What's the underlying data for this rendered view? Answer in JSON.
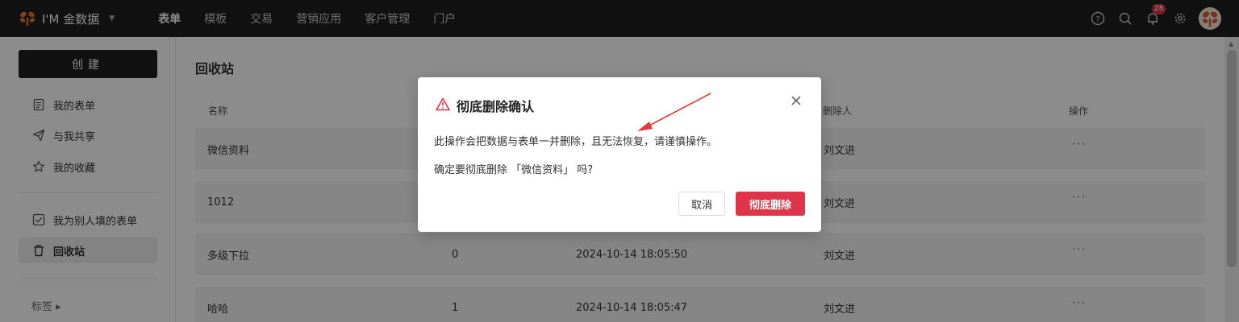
{
  "app": {
    "name": "I'M 金数据"
  },
  "nav": {
    "items": [
      {
        "label": "表单",
        "active": true
      },
      {
        "label": "模板",
        "active": false
      },
      {
        "label": "交易",
        "active": false
      },
      {
        "label": "营销应用",
        "active": false
      },
      {
        "label": "客户管理",
        "active": false
      },
      {
        "label": "门户",
        "active": false
      }
    ]
  },
  "toolbar": {
    "notification_count": "28",
    "icons": [
      "help-icon",
      "search-icon",
      "bell-icon",
      "gear-icon",
      "avatar"
    ]
  },
  "sidebar": {
    "create_label": "创建",
    "items": [
      {
        "label": "我的表单",
        "icon": "form-icon"
      },
      {
        "label": "与我共享",
        "icon": "send-icon"
      },
      {
        "label": "我的收藏",
        "icon": "star-icon"
      },
      {
        "label": "我为别人填的表单",
        "icon": "checkbox-icon"
      },
      {
        "label": "回收站",
        "icon": "trash-icon",
        "active": true
      }
    ],
    "tags_label": "标签 ▸"
  },
  "main": {
    "title": "回收站",
    "columns": {
      "name": "名称",
      "deleter": "删除人",
      "actions": "操作"
    },
    "rows": [
      {
        "name": "微信资料",
        "count": "",
        "time": "",
        "deleter": "刘文进",
        "actions": "···"
      },
      {
        "name": "1012",
        "count": "",
        "time": "",
        "deleter": "刘文进",
        "actions": "···"
      },
      {
        "name": "多级下拉",
        "count": "0",
        "time": "2024-10-14 18:05:50",
        "deleter": "刘文进",
        "actions": "···"
      },
      {
        "name": "哈哈",
        "count": "1",
        "time": "2024-10-14 18:05:47",
        "deleter": "刘文进",
        "actions": "···"
      }
    ]
  },
  "dialog": {
    "title": "彻底删除确认",
    "message": "此操作会把数据与表单一并删除，且无法恢复，请谨慎操作。",
    "confirm_question": "确定要彻底删除 「微信资料」 吗?",
    "cancel_label": "取消",
    "delete_label": "彻底删除"
  },
  "colors": {
    "topbar": "#1f1f1f",
    "danger": "#e0344a",
    "annotation_arrow": "#e53935"
  }
}
